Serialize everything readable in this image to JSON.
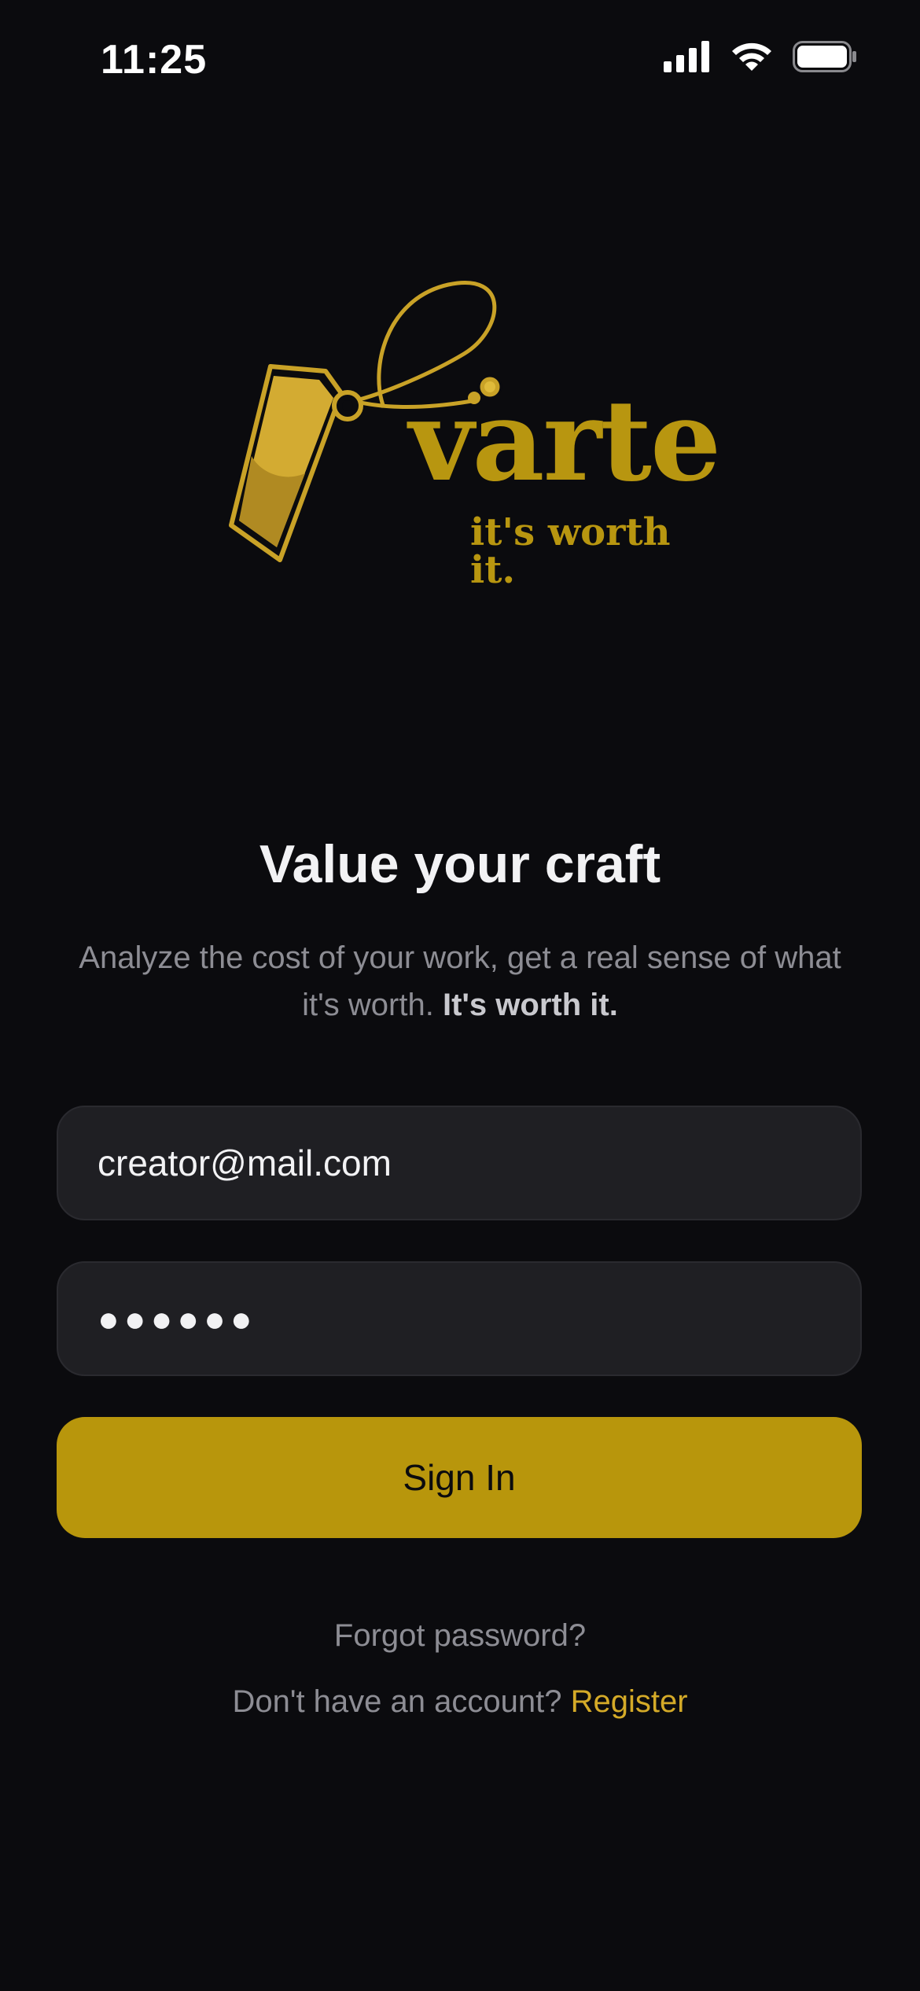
{
  "status_bar": {
    "time": "11:25",
    "icons": [
      "cellular-signal-icon",
      "wifi-icon",
      "battery-icon"
    ]
  },
  "brand": {
    "name": "varte",
    "tagline": "it's worth it.",
    "logo_icon": "price-tag-icon",
    "color": "#b89610"
  },
  "hero": {
    "title": "Value your craft",
    "subtitle_prefix": "Analyze the cost of your work, get a real sense of what it's worth.",
    "subtitle_emphasis": "It's worth it."
  },
  "form": {
    "email_value": "creator@mail.com",
    "password_masked": "●●●●●●",
    "sign_in_label": "Sign In"
  },
  "footer": {
    "forgot_label": "Forgot password?",
    "register_prompt": "Don't have an account?",
    "register_label": "Register"
  },
  "colors": {
    "background": "#0b0b0e",
    "accent": "#b8960c",
    "field_bg": "#1f1f23"
  }
}
